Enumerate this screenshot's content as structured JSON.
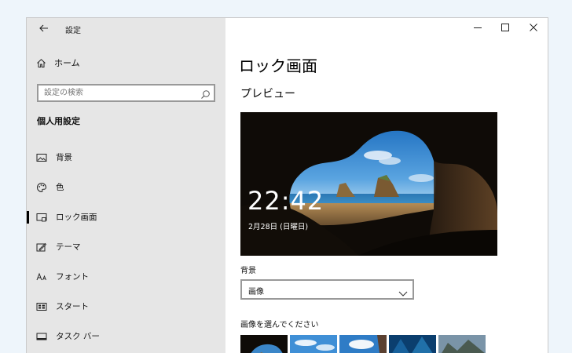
{
  "window": {
    "app_title": "設定",
    "minimize_icon": "minimize-icon",
    "maximize_icon": "maximize-icon",
    "close_icon": "close-icon"
  },
  "sidebar": {
    "home_label": "ホーム",
    "search_placeholder": "設定の検索",
    "section_title": "個人用設定",
    "items": [
      {
        "label": "背景",
        "icon": "picture-icon"
      },
      {
        "label": "色",
        "icon": "palette-icon"
      },
      {
        "label": "ロック画面",
        "icon": "lock-screen-icon",
        "selected": true
      },
      {
        "label": "テーマ",
        "icon": "theme-brush-icon"
      },
      {
        "label": "フォント",
        "icon": "font-icon"
      },
      {
        "label": "スタート",
        "icon": "start-icon"
      },
      {
        "label": "タスク バー",
        "icon": "taskbar-icon"
      }
    ]
  },
  "main": {
    "page_title": "ロック画面",
    "preview_heading": "プレビュー",
    "preview_time": "22:42",
    "preview_date": "2月28日 (日曜日)",
    "background_label": "背景",
    "background_value": "画像",
    "choose_image_label": "画像を選んでください"
  },
  "colors": {
    "sidebar_bg": "#e6e6e6",
    "page_bg": "#eef5fb",
    "accent": "#000000"
  }
}
